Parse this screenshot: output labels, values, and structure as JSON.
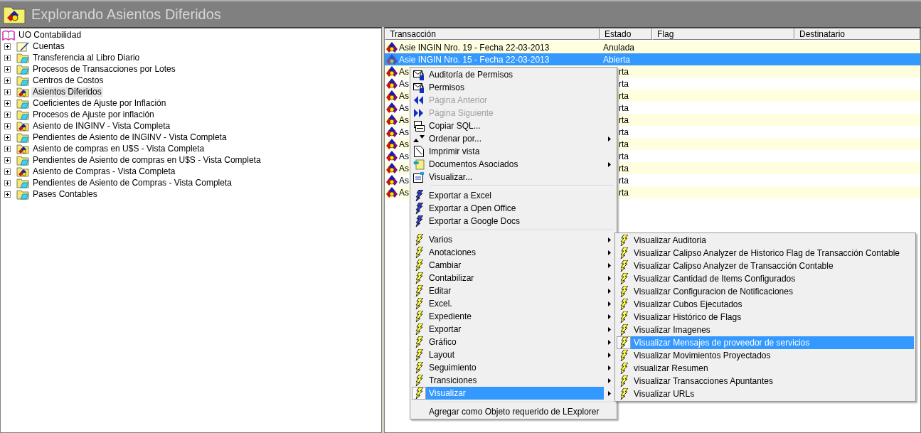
{
  "window": {
    "title": "Explorando Asientos Diferidos"
  },
  "tree": {
    "root": {
      "label": "UO Contabilidad",
      "kind": "root",
      "children": [
        {
          "label": "Cuentas",
          "kind": "document",
          "expanded": false,
          "selected": false
        },
        {
          "label": "Transferencia al Libro Diario",
          "kind": "folder",
          "expanded": false,
          "selected": false
        },
        {
          "label": "Procesos de Transacciones por Lotes",
          "kind": "folder",
          "expanded": false,
          "selected": false
        },
        {
          "label": "Centros de Costos",
          "kind": "folder",
          "expanded": false,
          "selected": false
        },
        {
          "label": "Asientos Diferidos",
          "kind": "entry",
          "expanded": false,
          "selected": true
        },
        {
          "label": "Coeficientes de Ajuste por Inflación",
          "kind": "folder",
          "expanded": false,
          "selected": false
        },
        {
          "label": "Procesos de Ajuste por inflación",
          "kind": "folder",
          "expanded": false,
          "selected": false
        },
        {
          "label": "Asiento de INGINV - Vista Completa",
          "kind": "entry",
          "expanded": false,
          "selected": false
        },
        {
          "label": "Pendientes de Asiento de INGINV - Vista Completa",
          "kind": "folder",
          "expanded": false,
          "selected": false
        },
        {
          "label": "Asiento de compras en U$S - Vista Completa",
          "kind": "entry",
          "expanded": false,
          "selected": false
        },
        {
          "label": "Pendientes de Asiento de compras en U$S - Vista Completa",
          "kind": "folder",
          "expanded": false,
          "selected": false
        },
        {
          "label": "Asiento de Compras - Vista Completa",
          "kind": "entry",
          "expanded": false,
          "selected": false
        },
        {
          "label": "Pendientes de Asiento de Compras - Vista Completa",
          "kind": "folder",
          "expanded": false,
          "selected": false
        },
        {
          "label": "Pases Contables",
          "kind": "folder",
          "expanded": false,
          "selected": false
        }
      ]
    }
  },
  "table": {
    "columns": [
      "Transacción",
      "Estado",
      "Flag",
      "Destinatario"
    ],
    "rows": [
      {
        "transaccion": "Asie INGIN Nro.  19 - Fecha 22-03-2013",
        "estado": "Anulada",
        "kind": "full",
        "selected": false
      },
      {
        "transaccion": "Asie INGIN Nro.  15 - Fecha 22-03-2013",
        "estado": "Abierta",
        "kind": "full",
        "selected": true
      },
      {
        "transaccion": "As",
        "estado": "rta",
        "kind": "covered",
        "selected": false
      },
      {
        "transaccion": "As",
        "estado": "rta",
        "kind": "covered",
        "selected": false
      },
      {
        "transaccion": "As",
        "estado": "rta",
        "kind": "covered",
        "selected": false
      },
      {
        "transaccion": "As",
        "estado": "rta",
        "kind": "covered",
        "selected": false
      },
      {
        "transaccion": "As",
        "estado": "rta",
        "kind": "covered",
        "selected": false
      },
      {
        "transaccion": "As",
        "estado": "rta",
        "kind": "covered",
        "selected": false
      },
      {
        "transaccion": "As",
        "estado": "rta",
        "kind": "covered",
        "selected": false
      },
      {
        "transaccion": "As",
        "estado": "rta",
        "kind": "covered",
        "selected": false
      },
      {
        "transaccion": "As",
        "estado": "rta",
        "kind": "covered",
        "selected": false
      },
      {
        "transaccion": "As",
        "estado": "rta",
        "kind": "covered",
        "selected": false
      },
      {
        "transaccion": "As",
        "estado": "rta",
        "kind": "covered",
        "selected": false
      }
    ]
  },
  "context_menu": {
    "sections": [
      {
        "items": [
          {
            "label": "Auditoría de Permisos",
            "kind": "permission",
            "disabled": false,
            "submenu": false,
            "selected": false
          },
          {
            "label": "Permisos",
            "kind": "permission",
            "disabled": false,
            "submenu": false,
            "selected": false
          },
          {
            "label": "Página Anterior",
            "kind": "prev",
            "disabled": true,
            "submenu": false,
            "selected": false
          },
          {
            "label": "Página Siguiente",
            "kind": "next",
            "disabled": true,
            "submenu": false,
            "selected": false
          },
          {
            "label": "Copiar SQL...",
            "kind": "sql",
            "disabled": false,
            "submenu": false,
            "selected": false
          },
          {
            "label": "Ordenar por...",
            "kind": "sort",
            "disabled": false,
            "submenu": true,
            "selected": false
          },
          {
            "label": "Imprimir vista",
            "kind": "print",
            "disabled": false,
            "submenu": false,
            "selected": false
          },
          {
            "label": "Documentos Asociados",
            "kind": "documents",
            "disabled": false,
            "submenu": true,
            "selected": false
          },
          {
            "label": "Visualizar...",
            "kind": "view",
            "disabled": false,
            "submenu": false,
            "selected": false
          }
        ]
      },
      {
        "items": [
          {
            "label": "Exportar a Excel",
            "kind": "export",
            "disabled": false,
            "submenu": false,
            "selected": false
          },
          {
            "label": "Exportar a Open Office",
            "kind": "export",
            "disabled": false,
            "submenu": false,
            "selected": false
          },
          {
            "label": "Exportar a Google Docs",
            "kind": "export",
            "disabled": false,
            "submenu": false,
            "selected": false
          }
        ]
      },
      {
        "items": [
          {
            "label": "Varios",
            "kind": "action",
            "disabled": false,
            "submenu": true,
            "selected": false
          },
          {
            "label": "Anotaciones",
            "kind": "action",
            "disabled": false,
            "submenu": true,
            "selected": false
          },
          {
            "label": "Cambiar",
            "kind": "action",
            "disabled": false,
            "submenu": true,
            "selected": false
          },
          {
            "label": "Contabilizar",
            "kind": "action",
            "disabled": false,
            "submenu": true,
            "selected": false
          },
          {
            "label": "Editar",
            "kind": "action",
            "disabled": false,
            "submenu": true,
            "selected": false
          },
          {
            "label": "Excel.",
            "kind": "action",
            "disabled": false,
            "submenu": true,
            "selected": false
          },
          {
            "label": "Expediente",
            "kind": "action",
            "disabled": false,
            "submenu": true,
            "selected": false
          },
          {
            "label": "Exportar",
            "kind": "action",
            "disabled": false,
            "submenu": true,
            "selected": false
          },
          {
            "label": "Gráfico",
            "kind": "action",
            "disabled": false,
            "submenu": true,
            "selected": false
          },
          {
            "label": "Layout",
            "kind": "action",
            "disabled": false,
            "submenu": true,
            "selected": false
          },
          {
            "label": "Seguimiento",
            "kind": "action",
            "disabled": false,
            "submenu": true,
            "selected": false
          },
          {
            "label": "Transiciones",
            "kind": "action",
            "disabled": false,
            "submenu": true,
            "selected": false
          },
          {
            "label": "Visualizar",
            "kind": "action",
            "disabled": false,
            "submenu": true,
            "selected": true
          }
        ]
      },
      {
        "items": [
          {
            "label": "Agregar como Objeto requerido de LExplorer",
            "kind": "plain",
            "disabled": false,
            "submenu": false,
            "selected": false
          }
        ]
      }
    ]
  },
  "submenu": {
    "items": [
      {
        "label": "Visualizar Auditoria",
        "selected": false
      },
      {
        "label": "Visualizar Calipso Analyzer de Historico Flag de Transacción Contable",
        "selected": false
      },
      {
        "label": "Visualizar Calipso Analyzer de Transacción Contable",
        "selected": false
      },
      {
        "label": "Visualizar Cantidad de Items Configurados",
        "selected": false
      },
      {
        "label": "Visualizar Configuracion de Notificaciones",
        "selected": false
      },
      {
        "label": "Visualizar Cubos Ejecutados",
        "selected": false
      },
      {
        "label": "Visualizar Histórico de Flags",
        "selected": false
      },
      {
        "label": "Visualizar Imagenes",
        "selected": false
      },
      {
        "label": "Visualizar Mensajes de proveedor de servicios",
        "selected": true
      },
      {
        "label": "Visualizar Movimientos Proyectados",
        "selected": false
      },
      {
        "label": "visualizar Resumen",
        "selected": false
      },
      {
        "label": "Visualizar Transacciones Apuntantes",
        "selected": false
      },
      {
        "label": "Visualizar URLs",
        "selected": false
      }
    ]
  }
}
